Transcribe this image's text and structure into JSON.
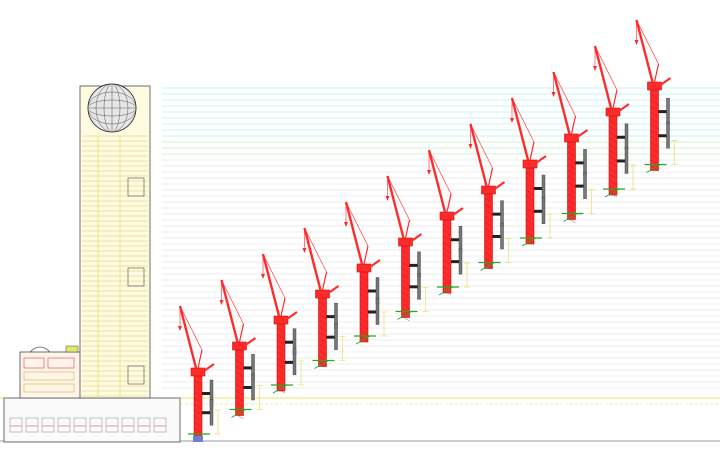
{
  "drawing": {
    "background": "#ffffff",
    "colors": {
      "crane": "#ff2a2a",
      "crane_dark": "#c81414",
      "level_line_cyan": "#8fe6ef",
      "level_line_green": "#9be59b",
      "level_line_gray": "#d9d9d9",
      "tower_outline": "#4a4a4a",
      "tower_fill": "#fffbe0",
      "tower_detail": "#c9b94a",
      "annotation_yellow": "#e8d84a",
      "base_green": "#22aa22",
      "mast_tie": "#222222"
    },
    "icons": [
      "tower-crane-icon",
      "sphere-dome-icon",
      "podium-building-icon"
    ],
    "crane_stages": [
      {
        "stage": 1
      },
      {
        "stage": 2
      },
      {
        "stage": 3
      },
      {
        "stage": 4
      },
      {
        "stage": 5
      },
      {
        "stage": 6
      },
      {
        "stage": 7
      },
      {
        "stage": 8
      },
      {
        "stage": 9
      },
      {
        "stage": 10
      },
      {
        "stage": 11
      },
      {
        "stage": 12
      }
    ]
  }
}
